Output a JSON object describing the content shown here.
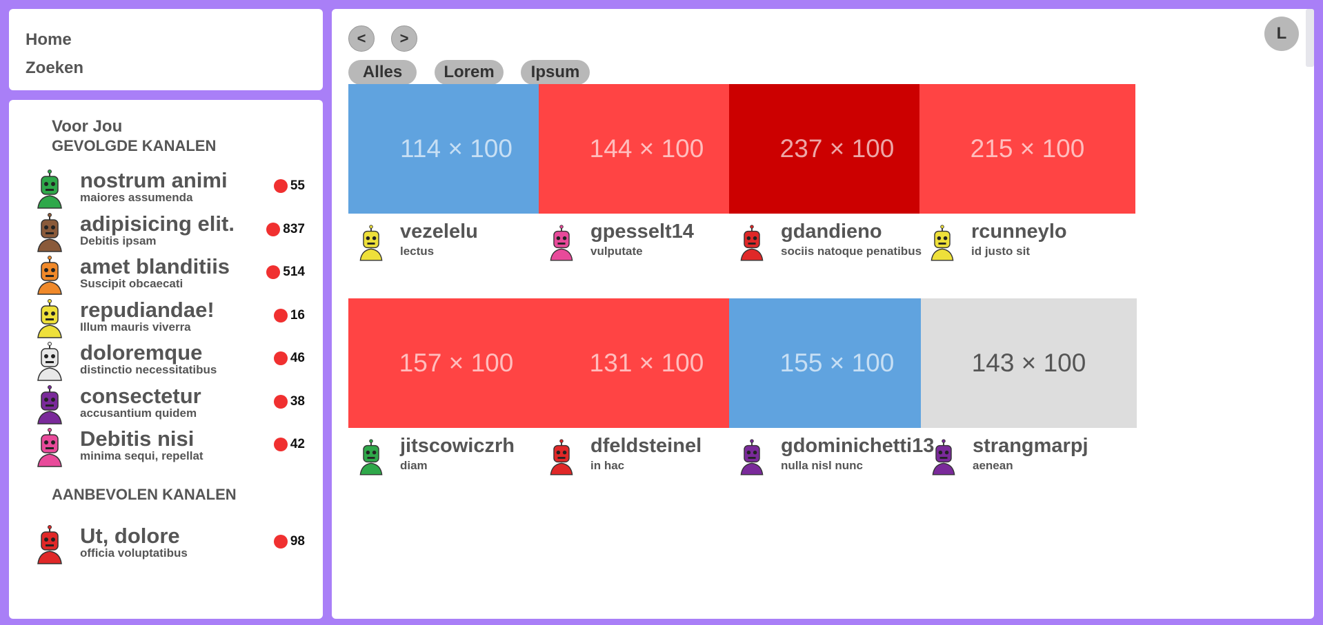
{
  "colors": {
    "background": "#a97ff7",
    "blue": "#60a3df",
    "red": "#ff4444",
    "darkred": "#cc0000",
    "gray": "#dddddd",
    "badge": "#f03030"
  },
  "nav": {
    "home": "Home",
    "zoeken": "Zoeken"
  },
  "sidebar": {
    "voor_jou": "Voor Jou",
    "gevolgd_title": "GEVOLGDE KANALEN",
    "gevolgd": [
      {
        "name": "nostrum animi",
        "sub": "maiores assumenda",
        "count": "55",
        "color": "#2fa84a",
        "icon": "green-robot-avatar"
      },
      {
        "name": "adipisicing elit.",
        "sub": "Debitis ipsam",
        "count": "837",
        "color": "#8a5a3a",
        "icon": "brown-robot-avatar"
      },
      {
        "name": "amet blanditiis",
        "sub": "Suscipit obcaecati",
        "count": "514",
        "color": "#f0892a",
        "icon": "orange-robot-avatar"
      },
      {
        "name": "repudiandae!",
        "sub": "Illum mauris viverra",
        "count": "16",
        "color": "#eee03a",
        "icon": "yellow-robot-avatar"
      },
      {
        "name": "doloremque",
        "sub": "distinctio necessitatibus",
        "count": "46",
        "color": "#e8e8e8",
        "icon": "white-robot-avatar"
      },
      {
        "name": "consectetur",
        "sub": "accusantium quidem",
        "count": "38",
        "color": "#7a2a9a",
        "icon": "purple-robot-avatar"
      },
      {
        "name": "Debitis nisi",
        "sub": "minima sequi, repellat",
        "count": "42",
        "color": "#e84a9a",
        "icon": "pink-robot-avatar"
      }
    ],
    "aanbevolen_title": "AANBEVOLEN KANALEN",
    "aanbevolen": [
      {
        "name": "Ut, dolore",
        "sub": "officia voluptatibus",
        "count": "98",
        "color": "#e02828",
        "icon": "red-robot-avatar"
      }
    ]
  },
  "main": {
    "back_label": "<",
    "forward_label": ">",
    "user_initial": "L",
    "filters": [
      "Alles",
      "Lorem",
      "Ipsum"
    ],
    "cards": [
      {
        "thumb_label": "114 × 100",
        "thumb_color": "#60a3df",
        "name": "vezelelu",
        "sub": "lectus",
        "avatar_color": "#eee03a"
      },
      {
        "thumb_label": "144 × 100",
        "thumb_color": "#ff4444",
        "name": "gpesselt14",
        "sub": "vulputate",
        "avatar_color": "#e84a9a"
      },
      {
        "thumb_label": "237 × 100",
        "thumb_color": "#cc0000",
        "name": "gdandieno",
        "sub": "sociis natoque penatibus",
        "avatar_color": "#e02828"
      },
      {
        "thumb_label": "215 × 100",
        "thumb_color": "#ff4444",
        "name": "rcunneylo",
        "sub": "id justo sit",
        "avatar_color": "#eee03a"
      },
      {
        "thumb_label": "157 × 100",
        "thumb_color": "#ff4444",
        "name": "jitscowiczrh",
        "sub": "diam",
        "avatar_color": "#2fa84a"
      },
      {
        "thumb_label": "131 × 100",
        "thumb_color": "#ff4444",
        "name": "dfeldsteinel",
        "sub": "in hac",
        "avatar_color": "#e02828"
      },
      {
        "thumb_label": "155 × 100",
        "thumb_color": "#60a3df",
        "name": "gdominichetti13",
        "sub": "nulla nisl nunc",
        "avatar_color": "#7a2a9a"
      },
      {
        "thumb_label": "143 × 100",
        "thumb_color": "#dddddd",
        "name": "strangmarpj",
        "sub": "aenean",
        "avatar_color": "#7a2a9a"
      }
    ]
  }
}
